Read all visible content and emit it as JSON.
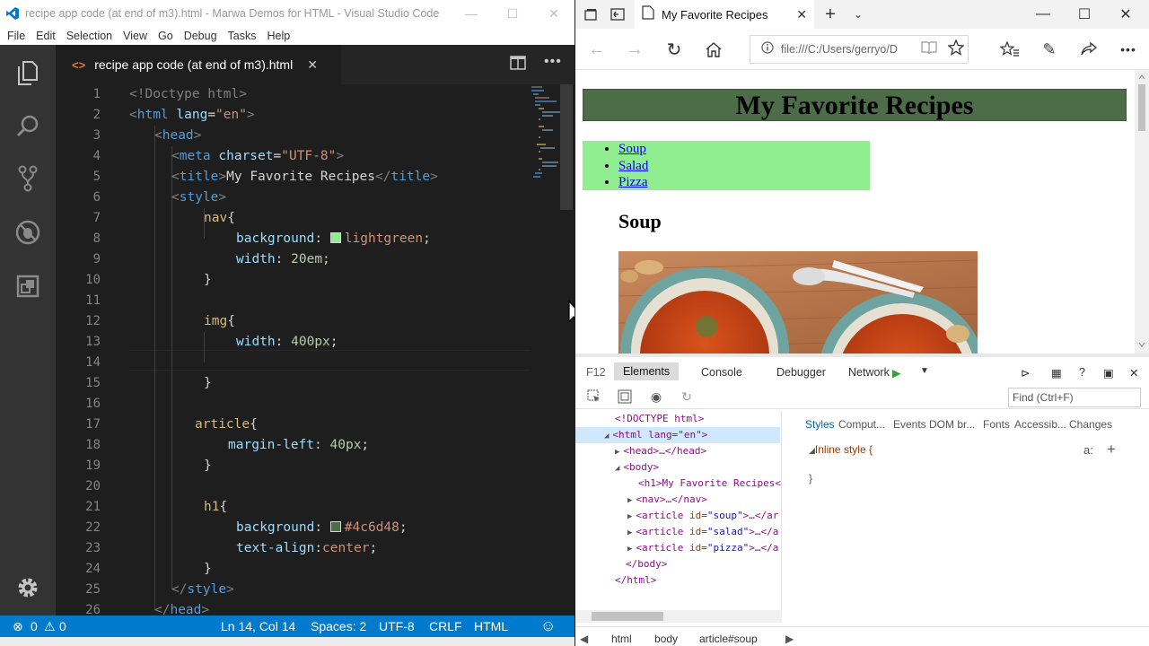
{
  "vscode": {
    "window_title": "recipe app code (at end of m3).html - Marwa Demos for HTML - Visual Studio Code",
    "menu": [
      "File",
      "Edit",
      "Selection",
      "View",
      "Go",
      "Debug",
      "Tasks",
      "Help"
    ],
    "tab_label": "recipe app code (at end of m3).html",
    "status": {
      "errors": "0",
      "warnings": "0",
      "position": "Ln 14, Col 14",
      "spaces": "Spaces: 2",
      "encoding": "UTF-8",
      "eol": "CRLF",
      "language": "HTML"
    },
    "line_numbers": [
      "1",
      "2",
      "3",
      "4",
      "5",
      "6",
      "7",
      "8",
      "9",
      "10",
      "11",
      "12",
      "13",
      "14",
      "15",
      "16",
      "17",
      "18",
      "19",
      "20",
      "21",
      "22",
      "23",
      "24",
      "25",
      "26"
    ],
    "code": {
      "l1": "<!Doctype html>",
      "l2_tag": "html",
      "l2_attr": "lang",
      "l2_val": "\"en\"",
      "l3": "head",
      "l4_tag": "meta",
      "l4_attr": "charset",
      "l4_val": "\"UTF-8\"",
      "l5_tag": "title",
      "l5_text": "My Favorite Recipes",
      "l6": "style",
      "l7": "nav",
      "l8_prop": "background",
      "l8_val": "lightgreen",
      "l9_prop": "width",
      "l9_val": "20em",
      "l12": "img",
      "l13_prop": "width",
      "l13_val": "400px",
      "l17": "article",
      "l18_prop": "margin-left",
      "l18_val": "40px",
      "l21": "h1",
      "l22_prop": "background",
      "l22_val": "#4c6d48",
      "l23_prop": "text-align",
      "l23_val": "center",
      "l25": "style",
      "l26": "head"
    },
    "swatches": {
      "lightgreen": "#90ee90",
      "h1": "#4c6d48"
    }
  },
  "edge": {
    "tab_title": "My Favorite Recipes",
    "url": "file:///C:/Users/gerryo/D",
    "page": {
      "h1": "My Favorite Recipes",
      "nav": [
        "Soup",
        "Salad",
        "Pizza"
      ],
      "article_h2": "Soup"
    },
    "devtools": {
      "f12": "F12",
      "tabs": [
        "Elements",
        "Console",
        "Debugger",
        "Network"
      ],
      "find_placeholder": "Find (Ctrl+F)",
      "dom": {
        "doctype": "<!DOCTYPE html>",
        "html": "<html lang=\"en\">",
        "head": "<head>…</head>",
        "body": "<body>",
        "h1": "<h1>My Favorite Recipes<",
        "nav": "<nav>…</nav>",
        "art_soup_a": "<article ",
        "art_soup_attr": "id",
        "art_soup_val": "\"soup\"",
        "art_soup_b": ">…</ar",
        "art_salad_a": "<article ",
        "art_salad_attr": "id",
        "art_salad_val": "\"salad\"",
        "art_salad_b": ">…</a",
        "art_pizza_a": "<article ",
        "art_pizza_attr": "id",
        "art_pizza_val": "\"pizza\"",
        "art_pizza_b": ">…</a",
        "body_close": "</body>",
        "html_close": "</html>"
      },
      "styles_tabs": [
        "Styles",
        "Comput...",
        "Events",
        "DOM br...",
        "Fonts",
        "Accessib...",
        "Changes"
      ],
      "inline_style": "Inline style  {",
      "inline_close": "}",
      "hov_label": "a:",
      "breadcrumb": [
        "html",
        "body",
        "article#soup"
      ]
    }
  },
  "colors": {
    "vscode_bg": "#1e1e1e",
    "statusbar": "#007acc",
    "h1_bg": "#4c6d48",
    "nav_bg": "#90ee90"
  }
}
